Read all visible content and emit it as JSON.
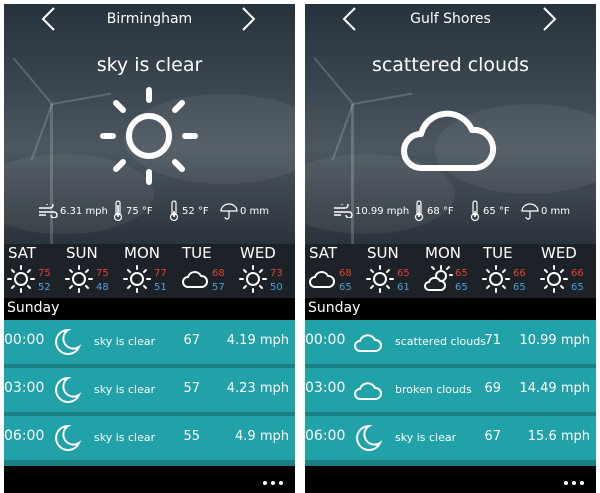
{
  "colors": {
    "hi_temp": "#e2413a",
    "lo_temp": "#4ea0dc",
    "row_bg": "#20a2a8"
  },
  "panels": [
    {
      "city": "Birmingham",
      "condition": "sky is clear",
      "main_icon": "sun-icon",
      "stats": {
        "wind": "6.31 mph",
        "temp_hi": "75 °F",
        "temp_lo": "52 °F",
        "rain": "0 mm"
      },
      "days": [
        {
          "name": "SAT",
          "icon": "sun-icon",
          "hi": "75",
          "lo": "52"
        },
        {
          "name": "SUN",
          "icon": "sun-icon",
          "hi": "75",
          "lo": "48"
        },
        {
          "name": "MON",
          "icon": "sun-icon",
          "hi": "77",
          "lo": "51"
        },
        {
          "name": "TUE",
          "icon": "cloud-icon",
          "hi": "68",
          "lo": "57"
        },
        {
          "name": "WED",
          "icon": "sun-icon",
          "hi": "73",
          "lo": "50"
        }
      ],
      "section_title": "Sunday",
      "hours": [
        {
          "time": "00:00",
          "icon": "moon-icon",
          "desc": "sky is clear",
          "temp": "67",
          "wind": "4.19 mph"
        },
        {
          "time": "03:00",
          "icon": "moon-icon",
          "desc": "sky is clear",
          "temp": "57",
          "wind": "4.23 mph"
        },
        {
          "time": "06:00",
          "icon": "moon-icon",
          "desc": "sky is clear",
          "temp": "55",
          "wind": "4.9 mph"
        }
      ]
    },
    {
      "city": "Gulf Shores",
      "condition": "scattered clouds",
      "main_icon": "cloud-icon",
      "stats": {
        "wind": "10.99 mph",
        "temp_hi": "68 °F",
        "temp_lo": "65 °F",
        "rain": "0 mm"
      },
      "days": [
        {
          "name": "SAT",
          "icon": "cloud-icon",
          "hi": "68",
          "lo": "65"
        },
        {
          "name": "SUN",
          "icon": "sun-icon",
          "hi": "65",
          "lo": "61"
        },
        {
          "name": "MON",
          "icon": "partly-cloudy-icon",
          "hi": "65",
          "lo": "65"
        },
        {
          "name": "TUE",
          "icon": "sun-icon",
          "hi": "66",
          "lo": "65"
        },
        {
          "name": "WED",
          "icon": "sun-icon",
          "hi": "66",
          "lo": "65"
        }
      ],
      "section_title": "Sunday",
      "hours": [
        {
          "time": "00:00",
          "icon": "cloud-icon",
          "desc": "scattered clouds",
          "temp": "71",
          "wind": "10.99 mph"
        },
        {
          "time": "03:00",
          "icon": "cloud-icon",
          "desc": "broken clouds",
          "temp": "69",
          "wind": "14.49 mph"
        },
        {
          "time": "06:00",
          "icon": "moon-icon",
          "desc": "sky is clear",
          "temp": "67",
          "wind": "15.6 mph"
        }
      ]
    }
  ]
}
